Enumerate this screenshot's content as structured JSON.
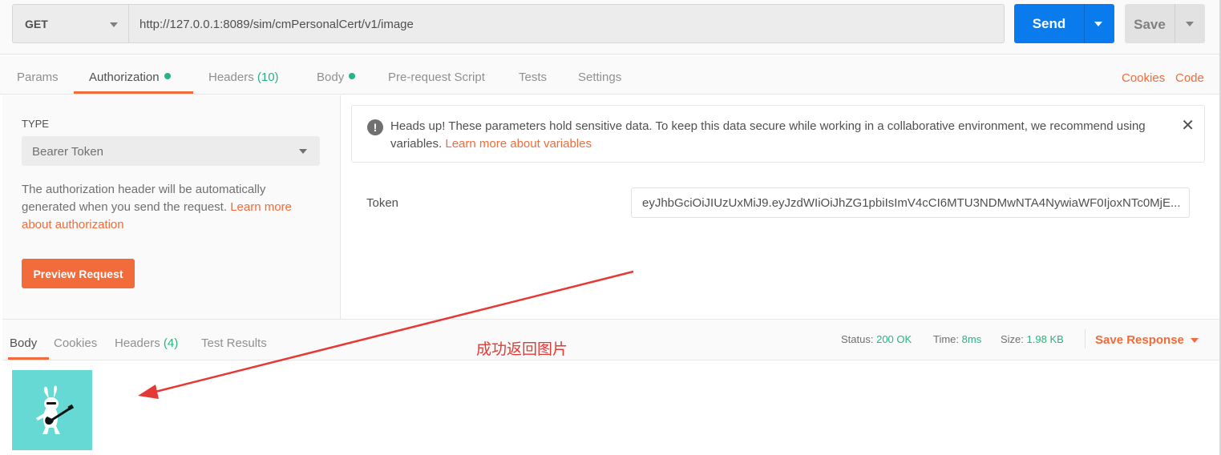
{
  "request": {
    "method": "GET",
    "url": "http://127.0.0.1:8089/sim/cmPersonalCert/v1/image",
    "send_label": "Send",
    "save_label": "Save"
  },
  "tabs": {
    "params": "Params",
    "authorization": "Authorization",
    "headers": "Headers",
    "headers_count": "(10)",
    "body": "Body",
    "pre_request": "Pre-request Script",
    "tests": "Tests",
    "settings": "Settings",
    "cookies_link": "Cookies",
    "code_link": "Code"
  },
  "auth": {
    "type_label": "TYPE",
    "type_value": "Bearer Token",
    "description": "The authorization header will be automatically generated when you send the request. ",
    "description_link": "Learn more about authorization",
    "preview_button": "Preview Request",
    "notice_text": "Heads up! These parameters hold sensitive data. To keep this data secure while working in a collaborative environment, we recommend using variables. ",
    "notice_link": "Learn more about variables",
    "token_label": "Token",
    "token_value": "eyJhbGciOiJIUzUxMiJ9.eyJzdWIiOiJhZG1pbiIsImV4cCI6MTU3NDMwNTA4NywiaWF0IjoxNTc0MjE..."
  },
  "response": {
    "tabs": {
      "body": "Body",
      "cookies": "Cookies",
      "headers": "Headers",
      "headers_count": "(4)",
      "test_results": "Test Results"
    },
    "status_label": "Status:",
    "status_value": "200 OK",
    "time_label": "Time:",
    "time_value": "8ms",
    "size_label": "Size:",
    "size_value": "1.98 KB",
    "save_response": "Save Response"
  },
  "annotation": {
    "text": "成功返回图片",
    "color": "#e53935"
  },
  "colors": {
    "accent": "#f26b3a",
    "send": "#097bed",
    "success": "#26b47f",
    "image_bg": "#66d9d5"
  }
}
